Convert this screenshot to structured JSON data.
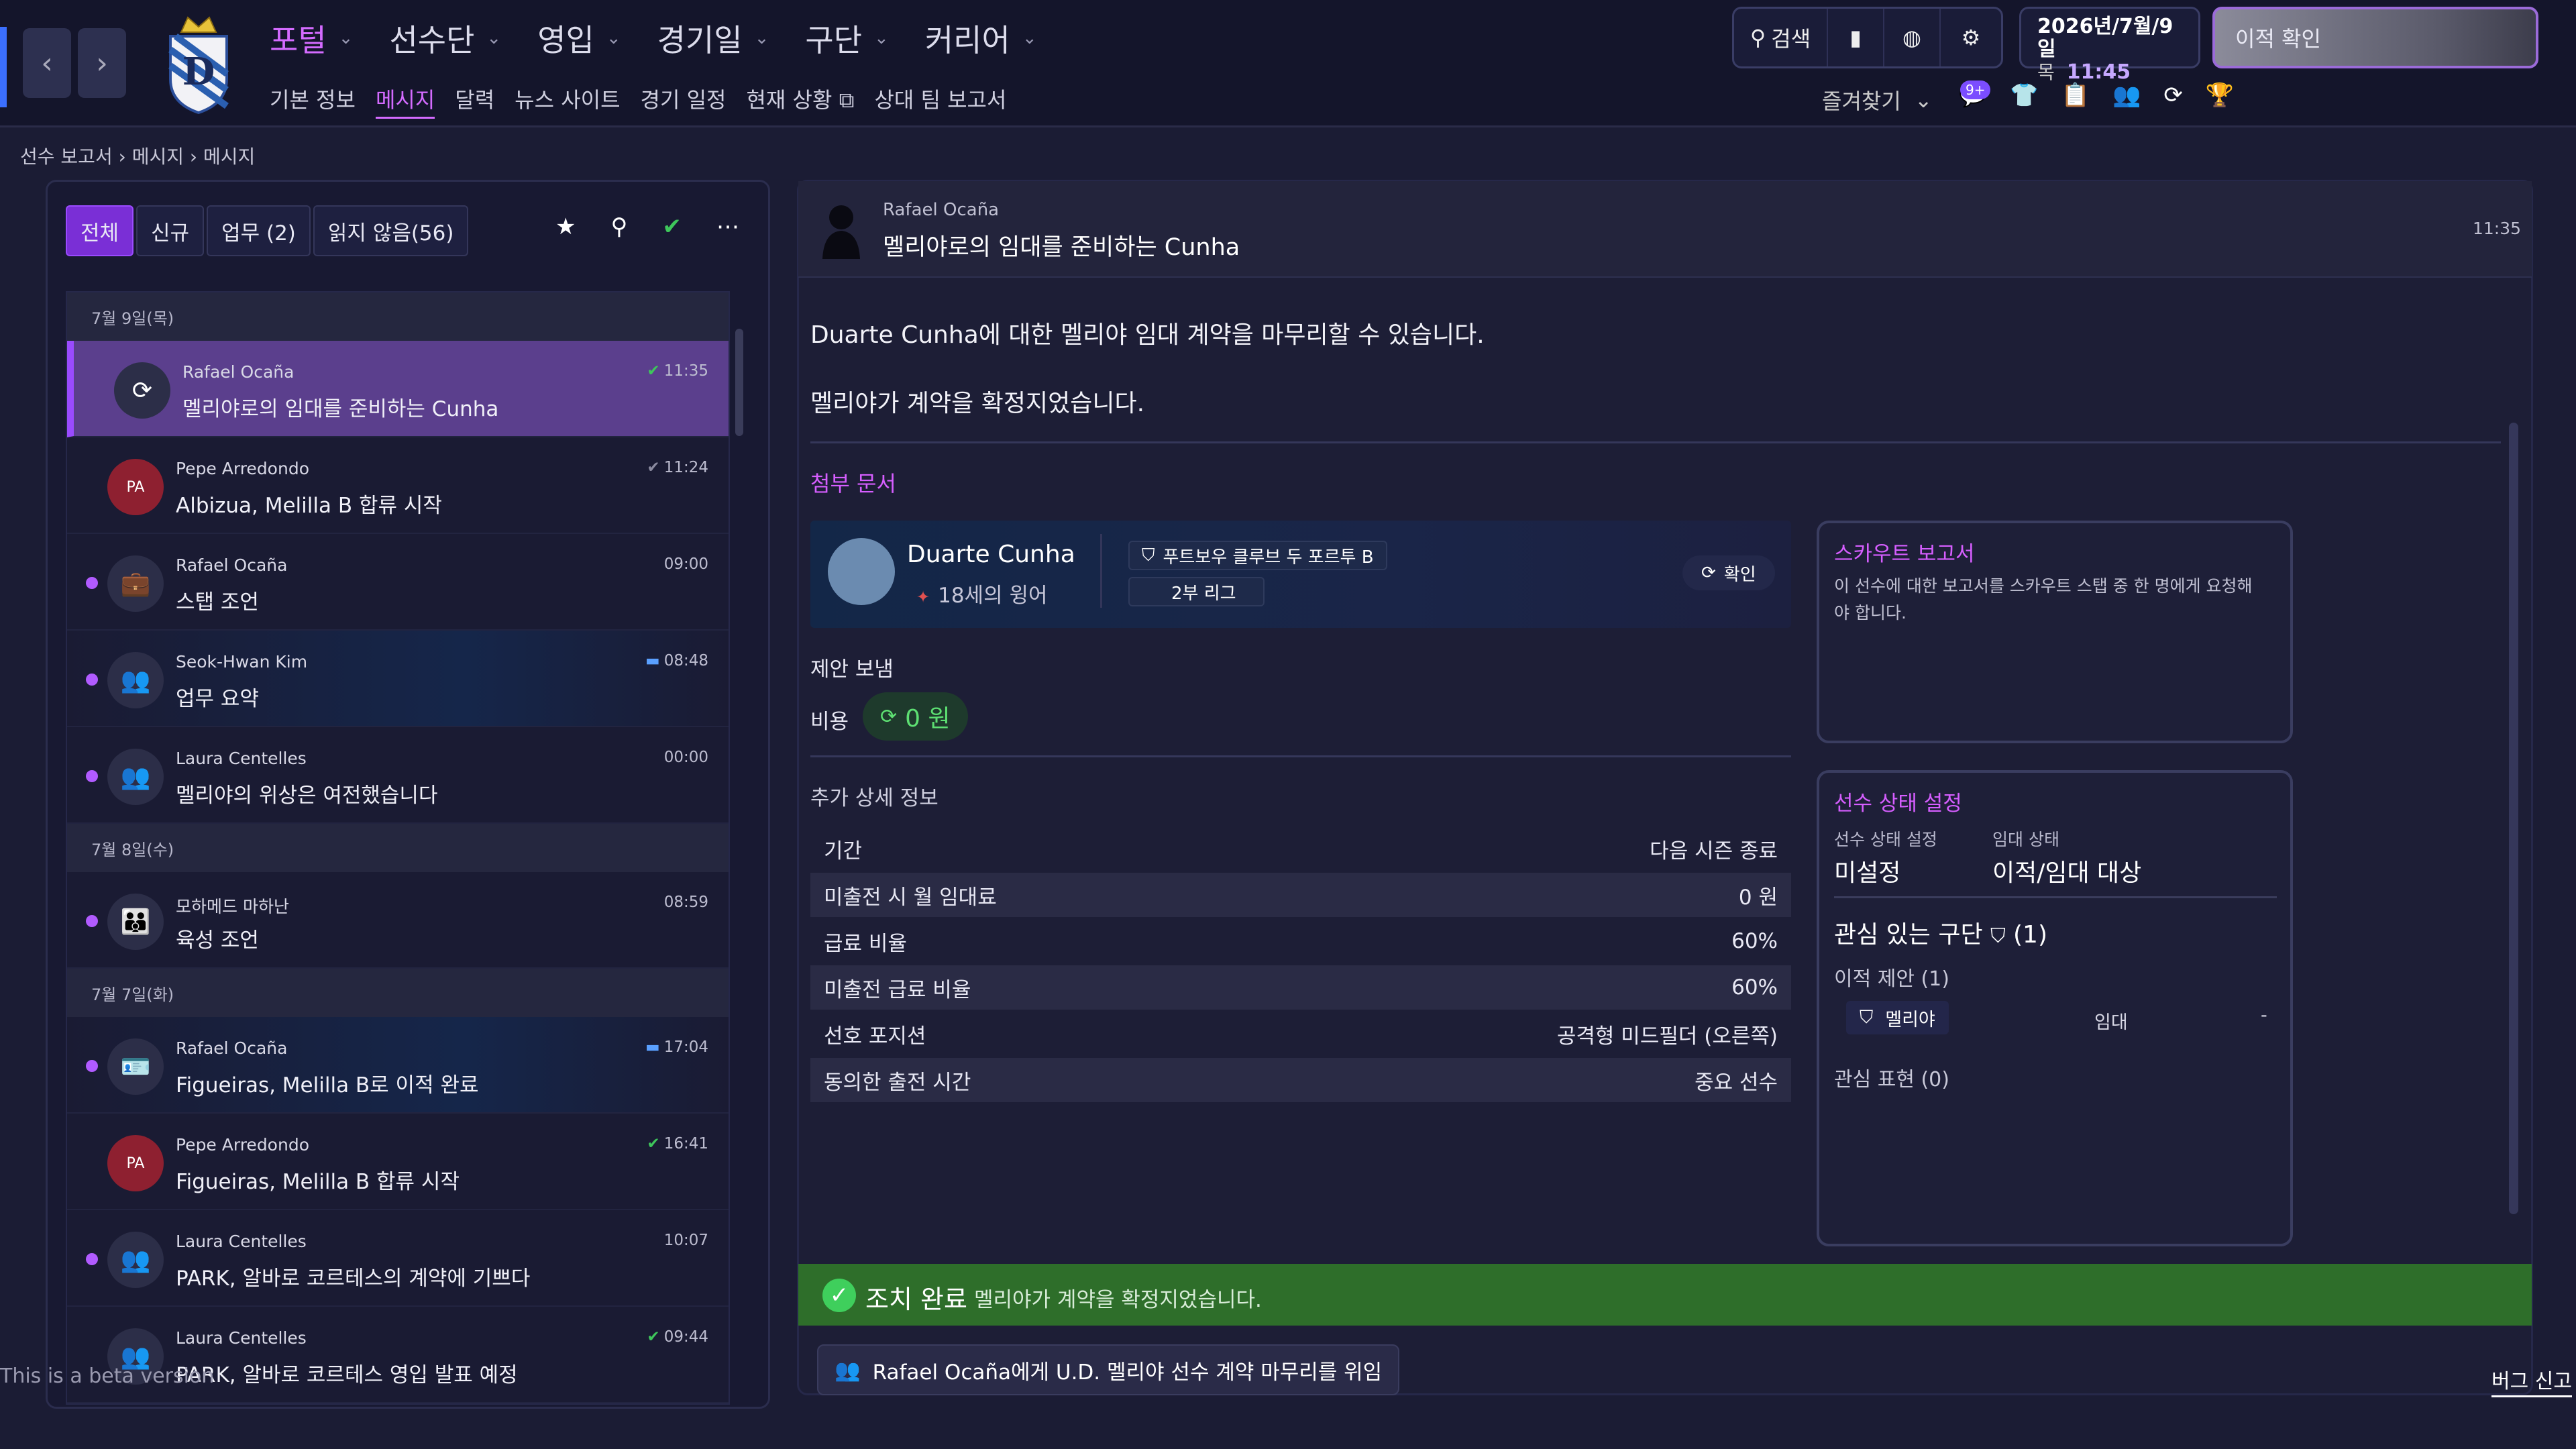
{
  "nav": {
    "main": [
      "포털",
      "선수단",
      "영입",
      "경기일",
      "구단",
      "커리어"
    ],
    "sub": [
      "기본 정보",
      "메시지",
      "달력",
      "뉴스 사이트",
      "경기 일정",
      "현재 상황",
      "상대 팀 보고서"
    ],
    "search_label": "검색",
    "date": "2026년/7월/9일",
    "weekday": "목",
    "time": "11:45",
    "transfer_button": "이적 확인",
    "favorites": "즐겨찾기",
    "badge": "9+"
  },
  "breadcrumb": [
    "선수 보고서",
    "메시지",
    "메시지"
  ],
  "filters": [
    "전체",
    "신규",
    "업무 (2)",
    "읽지 않음(56)"
  ],
  "inbox": {
    "groups": [
      {
        "date": "7월 9일(목)",
        "items": [
          {
            "from": "Rafael Ocaña",
            "subject": "멜리야로의 임대를 준비하는 Cunha",
            "time": "11:35",
            "avatar": "↻",
            "selected": true,
            "check": "green"
          },
          {
            "from": "Pepe Arredondo",
            "subject": "Albizua, Melilla B 합류 시작",
            "time": "11:24",
            "avatar": "PA",
            "check": "grey"
          },
          {
            "from": "Rafael Ocaña",
            "subject": "스탭 조언",
            "time": "09:00",
            "avatar": "briefcase",
            "unread": true
          },
          {
            "from": "Seok-Hwan Kim",
            "subject": "업무 요약",
            "time": "08:48",
            "avatar": "people",
            "unread": true,
            "comment": true
          },
          {
            "from": "Laura Centelles",
            "subject": "멜리야의 위상은 여전했습니다",
            "time": "00:00",
            "avatar": "people",
            "unread": true
          }
        ]
      },
      {
        "date": "7월 8일(수)",
        "items": [
          {
            "from": "모하메드 마하난",
            "subject": "육성 조언",
            "time": "08:59",
            "avatar": "group",
            "unread": true
          }
        ]
      },
      {
        "date": "7월 7일(화)",
        "items": [
          {
            "from": "Rafael Ocaña",
            "subject": "Figueiras, Melilla B로 이적 완료",
            "time": "17:04",
            "avatar": "card",
            "unread": true,
            "comment": true
          },
          {
            "from": "Pepe Arredondo",
            "subject": "Figueiras, Melilla B 합류 시작",
            "time": "16:41",
            "avatar": "PA",
            "check": "green"
          },
          {
            "from": "Laura Centelles",
            "subject": "PARK, 알바로 코르테스의 계약에 기쁘다",
            "time": "10:07",
            "avatar": "people",
            "unread": true
          },
          {
            "from": "Laura Centelles",
            "subject": "PARK, 알바로 코르테스 영입 발표 예정",
            "time": "09:44",
            "avatar": "people",
            "check": "green"
          }
        ]
      }
    ]
  },
  "message": {
    "from": "Rafael Ocaña",
    "subject": "멜리야로의 임대를 준비하는 Cunha",
    "time": "11:35",
    "body1": "Duarte Cunha에 대한 멜리야 임대 계약을 마무리할 수 있습니다.",
    "body2": "멜리야가 계약을 확정지었습니다.",
    "attachments": "첨부 문서",
    "player": {
      "name": "Duarte Cunha",
      "desc": "18세의 윙어",
      "club": "푸트보우 클루브 두 포르투 B",
      "league": "2부 리그",
      "confirm": "확인"
    },
    "offer_sent": "제안 보냄",
    "cost_label": "비용",
    "cost_value": "0 원",
    "extra_title": "추가 상세 정보",
    "details": [
      {
        "k": "기간",
        "v": "다음 시즌 종료"
      },
      {
        "k": "미출전 시 월 임대료",
        "v": "0 원"
      },
      {
        "k": "급료 비율",
        "v": "60%"
      },
      {
        "k": "미출전 급료 비율",
        "v": "60%"
      },
      {
        "k": "선호 포지션",
        "v": "공격형 미드필더 (오른쪽)"
      },
      {
        "k": "동의한 출전 시간",
        "v": "중요 선수"
      }
    ]
  },
  "scout": {
    "title": "스카우트 보고서",
    "desc": "이 선수에 대한 보고서를 스카우트 스탭 중 한 명에게 요청해야 합니다."
  },
  "status": {
    "title": "선수 상태 설정",
    "label1": "선수 상태 설정",
    "value1": "미설정",
    "label2": "임대 상태",
    "value2": "이적/임대 대상",
    "interest": "관심 있는 구단",
    "interest_count": "(1)",
    "offers": "이적 제안 (1)",
    "offer_club": "멜리야",
    "offer_type": "임대",
    "offer_dash": "-",
    "shows": "관심 표현 (0)"
  },
  "action": {
    "title": "조치 완료",
    "desc": "멜리야가 계약을 확정지었습니다.",
    "delegate": "Rafael Ocaña에게 U.D. 멜리야 선수 계약 마무리를 위임"
  },
  "footer": {
    "beta": "This is a beta version",
    "bug": "버그 신고"
  }
}
